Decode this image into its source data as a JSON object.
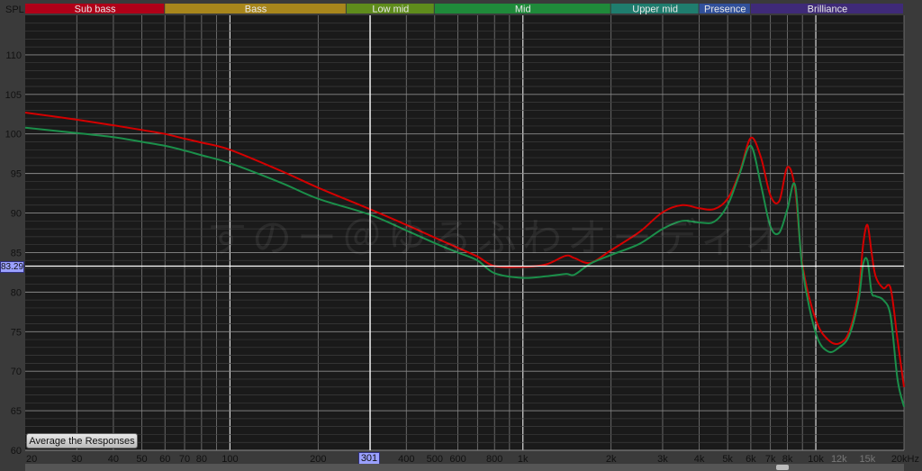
{
  "app": {
    "y_axis_title": "SPL",
    "watermark": "すのー＠ゆるふわオーディオ",
    "average_button_label": "Average the Responses",
    "cursor": {
      "y_value_label": "83.29",
      "x_value_label": "301",
      "y_value": 83.29,
      "x_value": 301
    }
  },
  "colors": {
    "background": "#1a1a1a",
    "frame": "#3a3a3a",
    "red_series": "#d40000",
    "green_series": "#1b8f4a",
    "cursor_line": "#ffffff"
  },
  "bands": [
    {
      "label": "Sub bass",
      "from": 20,
      "to": 60,
      "color": "#b00018"
    },
    {
      "label": "Bass",
      "from": 60,
      "to": 250,
      "color": "#a8861c"
    },
    {
      "label": "Low mid",
      "from": 250,
      "to": 500,
      "color": "#5f8c1c"
    },
    {
      "label": "Mid",
      "from": 500,
      "to": 2000,
      "color": "#1f8a3a"
    },
    {
      "label": "Upper mid",
      "from": 2000,
      "to": 4000,
      "color": "#1f7d6e"
    },
    {
      "label": "Presence",
      "from": 4000,
      "to": 6000,
      "color": "#31509a"
    },
    {
      "label": "Brilliance",
      "from": 6000,
      "to": 20000,
      "color": "#3f2a78"
    }
  ],
  "chart_data": {
    "type": "line",
    "xscale": "log",
    "xlim": [
      20,
      20000
    ],
    "ylim": [
      60,
      115
    ],
    "ylabel": "SPL",
    "grid": true,
    "x_ticks": [
      {
        "value": 20,
        "label": "20"
      },
      {
        "value": 30,
        "label": "30"
      },
      {
        "value": 40,
        "label": "40"
      },
      {
        "value": 50,
        "label": "50"
      },
      {
        "value": 60,
        "label": "60"
      },
      {
        "value": 70,
        "label": "70"
      },
      {
        "value": 80,
        "label": "80"
      },
      {
        "value": 100,
        "label": "100"
      },
      {
        "value": 200,
        "label": "200"
      },
      {
        "value": 400,
        "label": "400"
      },
      {
        "value": 500,
        "label": "500"
      },
      {
        "value": 600,
        "label": "600"
      },
      {
        "value": 800,
        "label": "800"
      },
      {
        "value": 1000,
        "label": "1k"
      },
      {
        "value": 2000,
        "label": "2k"
      },
      {
        "value": 3000,
        "label": "3k"
      },
      {
        "value": 4000,
        "label": "4k"
      },
      {
        "value": 5000,
        "label": "5k"
      },
      {
        "value": 6000,
        "label": "6k"
      },
      {
        "value": 7000,
        "label": "7k"
      },
      {
        "value": 8000,
        "label": "8k"
      },
      {
        "value": 10000,
        "label": "10k"
      },
      {
        "value": 12000,
        "label": "12k"
      },
      {
        "value": 15000,
        "label": "15k"
      },
      {
        "value": 20000,
        "label": "20kHz"
      }
    ],
    "y_ticks": [
      60,
      65,
      70,
      75,
      80,
      85,
      90,
      95,
      100,
      105,
      110
    ],
    "series": [
      {
        "color": "#d40000",
        "x": [
          20,
          30,
          40,
          50,
          60,
          70,
          80,
          100,
          150,
          200,
          300,
          400,
          500,
          600,
          700,
          800,
          1000,
          1200,
          1400,
          1500,
          1700,
          2000,
          2500,
          3000,
          3500,
          4000,
          4500,
          5000,
          5500,
          6000,
          6500,
          7000,
          7500,
          8000,
          8500,
          9000,
          10000,
          11000,
          12000,
          13000,
          14000,
          14500,
          15000,
          15500,
          16000,
          17000,
          18000,
          19000,
          20000
        ],
        "y": [
          102.7,
          101.8,
          101.1,
          100.5,
          100.0,
          99.4,
          98.9,
          98.0,
          95.3,
          93.2,
          90.5,
          88.5,
          86.9,
          85.6,
          84.5,
          83.3,
          83.2,
          83.5,
          84.6,
          84.3,
          83.7,
          85.3,
          87.6,
          90.1,
          91.0,
          90.6,
          90.5,
          91.8,
          95.2,
          99.5,
          97.0,
          92.2,
          91.5,
          95.8,
          93.0,
          83.5,
          76.5,
          74.0,
          73.5,
          75.0,
          80.0,
          86.0,
          88.5,
          85.0,
          82.0,
          80.5,
          80.5,
          74.0,
          68.0
        ]
      },
      {
        "color": "#1b8f4a",
        "x": [
          20,
          30,
          40,
          50,
          60,
          70,
          80,
          100,
          150,
          200,
          300,
          400,
          500,
          600,
          700,
          800,
          1000,
          1200,
          1400,
          1500,
          1700,
          2000,
          2500,
          3000,
          3500,
          4000,
          4500,
          5000,
          5500,
          6000,
          6500,
          7000,
          7500,
          8000,
          8500,
          9000,
          10000,
          11000,
          12000,
          13000,
          14000,
          14500,
          15000,
          15500,
          16000,
          17000,
          18000,
          19000,
          20000
        ],
        "y": [
          100.8,
          100.1,
          99.6,
          99.0,
          98.5,
          97.9,
          97.3,
          96.3,
          93.8,
          91.8,
          89.8,
          87.8,
          86.2,
          85.0,
          84.0,
          82.4,
          81.8,
          82.0,
          82.3,
          82.2,
          83.6,
          84.7,
          86.1,
          88.0,
          89.0,
          88.8,
          88.9,
          91.0,
          95.0,
          98.5,
          93.5,
          88.3,
          87.5,
          90.5,
          93.5,
          83.0,
          74.8,
          72.5,
          73.0,
          74.5,
          79.0,
          83.5,
          84.0,
          80.0,
          79.5,
          79.0,
          77.0,
          69.0,
          65.5
        ]
      }
    ]
  }
}
